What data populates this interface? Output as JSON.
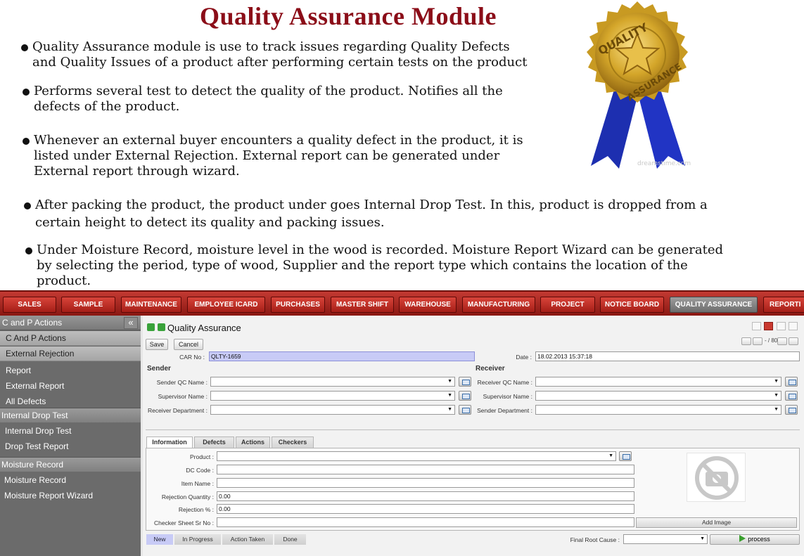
{
  "slide": {
    "title": "Quality Assurance Module",
    "bullets": [
      {
        "lines": [
          "Quality Assurance module is use to track issues regarding Quality Defects",
          "and Quality Issues of a product after performing certain tests on the product"
        ]
      },
      {
        "lines": [
          "Performs several test to detect the quality of the product. Notifies all the",
          "defects of the product."
        ]
      },
      {
        "lines": [
          "Whenever an external buyer encounters a quality defect in the product, it is",
          "listed under External Rejection. External report can be generated under",
          "External report through wizard."
        ]
      },
      {
        "lines": [
          "After packing the product, the product under goes Internal Drop Test. In this, product is dropped from a",
          "certain height to detect its quality and packing issues."
        ]
      },
      {
        "lines": [
          "Under Moisture Record, moisture level in the wood is recorded. Moisture Report Wizard can be generated",
          "by selecting the period, type of wood, Supplier and the report type which contains the location of the",
          "product."
        ]
      }
    ],
    "seal": {
      "top_text": "QUALITY",
      "bottom_text": "ASSURANCE",
      "credit": "dreamstime.com",
      "gold": "#d4a62a",
      "ribbon": "#1d2fb0"
    }
  },
  "menu": {
    "items": [
      "SALES",
      "SAMPLE",
      "MAINTENANCE",
      "EMPLOYEE ICARD",
      "PURCHASES",
      "MASTER SHIFT",
      "WAREHOUSE",
      "MANUFACTURING",
      "PROJECT",
      "NOTICE BOARD",
      "QUALITY ASSURANCE",
      "REPORTI"
    ],
    "active": "QUALITY ASSURANCE",
    "bar_color": "#a41f18"
  },
  "sidebar": {
    "header": "C and P Actions",
    "collapse_icon": "«",
    "sub1": "C And P Actions",
    "sub2": "External Rejection",
    "ext_items": [
      "Report",
      "External Report",
      "All Defects"
    ],
    "sec_internal": "Internal Drop Test",
    "internal_items": [
      "Internal Drop Test",
      "Drop Test Report"
    ],
    "sec_moisture": "Moisture Record",
    "moisture_items": [
      "Moisture Record",
      "Moisture Report Wizard"
    ]
  },
  "form": {
    "title": "Quality Assurance",
    "save": "Save",
    "cancel": "Cancel",
    "pager": "- / 80",
    "car_label": "CAR No :",
    "car_value": "QLTY-1659",
    "date_label": "Date :",
    "date_value": "18.02.2013 15:37:18",
    "sender_head": "Sender",
    "receiver_head": "Receiver",
    "sender_qc": "Sender QC Name :",
    "supervisor": "Supervisor Name :",
    "receiver_dept": "Receiver Department :",
    "receiver_qc": "Receiver QC Name :",
    "supervisor2": "Supervisor Name :",
    "sender_dept": "Sender Department :"
  },
  "tabs": [
    "Information",
    "Defects",
    "Actions",
    "Checkers"
  ],
  "info": {
    "product": "Product :",
    "dc_code": "DC Code :",
    "item_name": "Item Name :",
    "rej_qty": "Rejection Quantity :",
    "rej_qty_value": "0.00",
    "rej_pct": "Rejection % :",
    "rej_pct_value": "0.00",
    "checker": "Checker Sheet Sr No :",
    "add_image": "Add Image"
  },
  "workflow": {
    "stages": [
      "New",
      "In Progress",
      "Action Taken",
      "Done"
    ],
    "final_root_cause": "Final Root Cause :",
    "process": "process"
  }
}
